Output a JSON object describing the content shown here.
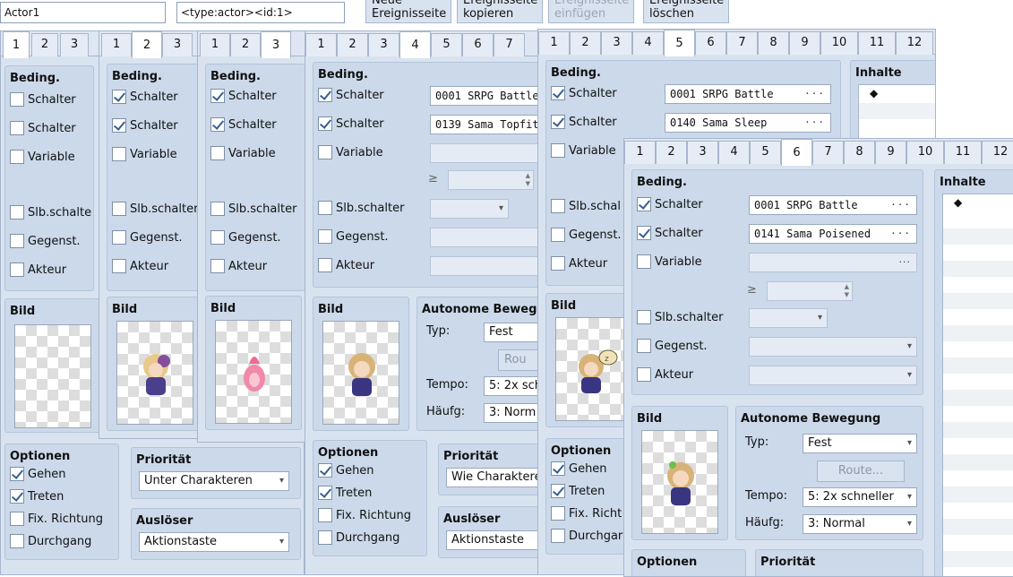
{
  "top": {
    "name_value": "Actor1",
    "note_value": "<type:actor><id:1>",
    "buttons": [
      {
        "line1": "Neue",
        "line2": "Ereignisseite"
      },
      {
        "line1": "Ereignisseite",
        "line2": "kopieren"
      },
      {
        "line1": "Ereignisseite",
        "line2": "einfügen"
      },
      {
        "line1": "Ereignisseite",
        "line2": "löschen"
      }
    ]
  },
  "labels": {
    "bedingungen": "Beding.",
    "schalter": "Schalter",
    "variable": "Variable",
    "slb_schalter": "Slb.schalter",
    "slb_schalter_cut": "Slb.schalte",
    "slb_schal_cut": "Slb.schal",
    "gegenst": "Gegenst.",
    "akteur": "Akteur",
    "bild": "Bild",
    "optionen": "Optionen",
    "gehen": "Gehen",
    "treten": "Treten",
    "fix_richtung": "Fix. Richtung",
    "fix_richt_cut": "Fix. Richt",
    "durchgang": "Durchgang",
    "durchgar_cut": "Durchgar",
    "prioritaet": "Priorität",
    "ausloeser": "Auslöser",
    "autonome": "Autonome Bewegung",
    "autonome_cut": "Autonome Bewegu",
    "typ": "Typ:",
    "tempo": "Tempo:",
    "haeufg": "Häufg:",
    "inhalte": "Inhalte",
    "route": "Route...",
    "rou_cut": "Rou",
    "ge": "≥",
    "dots": "···",
    "bullet": "◆"
  },
  "values": {
    "unter_charakteren": "Unter Charakteren",
    "wie_charaktere": "Wie Charaktere",
    "aktionstaste": "Aktionstaste",
    "fest": "Fest",
    "tempo_full": "5: 2x schneller",
    "tempo_cut": "5: 2x sch",
    "haeufg_full": "3: Normal",
    "haeufg_cut": "3: Norm",
    "sw_0001": "0001 SRPG Battle",
    "sw_0139": "0139 Sama Topfit",
    "sw_0140": "0140 Sama Sleep",
    "sw_0141": "0141 Sama Poisened"
  },
  "tabs": {
    "w1": [
      "1",
      "2",
      "3"
    ],
    "w2": [
      "1",
      "2",
      "3"
    ],
    "w3": [
      "1",
      "2",
      "3"
    ],
    "w4": [
      "1",
      "2",
      "3",
      "4",
      "5",
      "6",
      "7"
    ],
    "w5": [
      "1",
      "2",
      "3",
      "4",
      "5",
      "6",
      "7",
      "8",
      "9",
      "10",
      "11",
      "12"
    ],
    "w6": [
      "1",
      "2",
      "3",
      "4",
      "5",
      "6",
      "7",
      "8",
      "9",
      "10",
      "11",
      "12"
    ]
  },
  "colors": {
    "window_bg": "#d9e3f0",
    "group_bg": "#ccd9ea",
    "check": "#3a5f93"
  }
}
